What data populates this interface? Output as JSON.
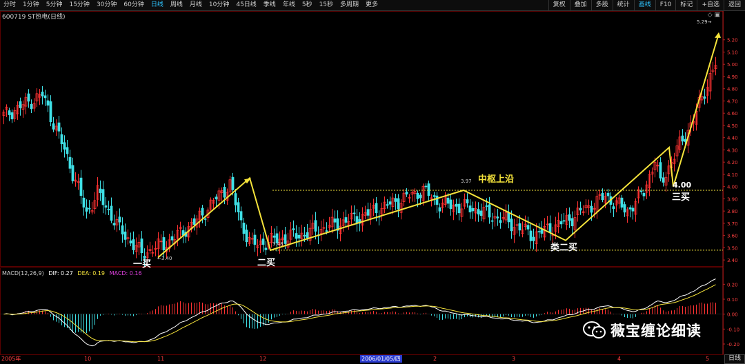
{
  "toolbar": {
    "left": [
      "分时",
      "1分钟",
      "5分钟",
      "15分钟",
      "30分钟",
      "60分钟",
      "日线",
      "周线",
      "月线",
      "10分钟",
      "45日线",
      "季线",
      "年线",
      "5秒",
      "15秒",
      "多周期",
      "更多"
    ],
    "active_index": 6,
    "right": [
      "复权",
      "叠加",
      "多股",
      "统计",
      "画线",
      "F10",
      "标记",
      "+自选",
      "返回"
    ],
    "right_active_index": 4
  },
  "title": "600719 ST热电(日线)",
  "top_icons": "◇ ▣",
  "macd_legend": {
    "name": "MACD(12,26,9)",
    "dif": "DIF: 0.27",
    "dea": "DEA: 0.19",
    "macd": "MACD: 0.16",
    "dif_color": "#ffffff",
    "dea_color": "#f5e33b",
    "macd_color": "#e040e0"
  },
  "annotations": {
    "buy1": "一买",
    "buy2": "二买",
    "buy3": "三买",
    "buy2_like": "类二买",
    "hub_top": "中枢上沿",
    "price_340": "3.40",
    "price_348": "3.48",
    "price_397": "3.97",
    "price_400": "4.00",
    "price_529": "5.29"
  },
  "watermark": "薇宝缠论细读",
  "x_axis": {
    "labels": [
      "2005年",
      "10",
      "11",
      "12",
      "2006/01/05/四",
      "2",
      "3",
      "4",
      "5"
    ],
    "highlight_index": 4
  },
  "period_tag": "日线",
  "colors": {
    "up": "#ff3232",
    "down": "#3fe0e6",
    "trend": "#f5e33b",
    "axis": "#ff4040"
  },
  "chart_data": {
    "type": "candlestick",
    "y_ticks": [
      "5.20",
      "5.10",
      "5.00",
      "4.90",
      "4.80",
      "4.70",
      "4.60",
      "4.50",
      "4.40",
      "4.30",
      "4.20",
      "4.10",
      "4.00",
      "3.90",
      "3.80",
      "3.70",
      "3.60",
      "3.50",
      "3.40"
    ],
    "ylim": [
      3.35,
      5.3
    ],
    "macd_ticks": [
      "0.20",
      "0.10",
      "0.00",
      "-0.10",
      "-0.20"
    ],
    "macd_ylim": [
      -0.26,
      0.28
    ],
    "trend_points": [
      3.42,
      4.07,
      3.48,
      3.97,
      3.56,
      4.32,
      4.0,
      5.25
    ],
    "hub_levels": [
      3.97,
      3.48
    ]
  }
}
